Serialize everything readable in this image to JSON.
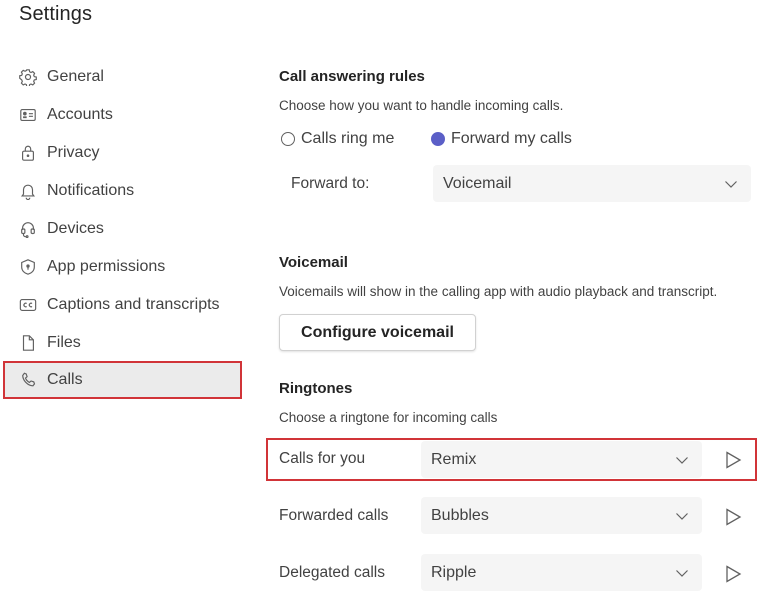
{
  "page": {
    "title": "Settings"
  },
  "sidebar": {
    "items": [
      {
        "label": "General",
        "icon": "gear-icon"
      },
      {
        "label": "Accounts",
        "icon": "id-card-icon"
      },
      {
        "label": "Privacy",
        "icon": "lock-icon"
      },
      {
        "label": "Notifications",
        "icon": "bell-icon"
      },
      {
        "label": "Devices",
        "icon": "headset-icon"
      },
      {
        "label": "App permissions",
        "icon": "shield-icon"
      },
      {
        "label": "Captions and transcripts",
        "icon": "closed-captions-icon"
      },
      {
        "label": "Files",
        "icon": "file-icon"
      },
      {
        "label": "Calls",
        "icon": "phone-icon",
        "active": true
      }
    ]
  },
  "call_answering": {
    "title": "Call answering rules",
    "description": "Choose how you want to handle incoming calls.",
    "options": [
      {
        "label": "Calls ring me",
        "checked": false
      },
      {
        "label": "Forward my calls",
        "checked": true
      }
    ],
    "forward_to": {
      "label": "Forward to:",
      "value": "Voicemail"
    }
  },
  "voicemail": {
    "title": "Voicemail",
    "description": "Voicemails will show in the calling app with audio playback and transcript.",
    "configure_button": "Configure voicemail"
  },
  "ringtones": {
    "title": "Ringtones",
    "description": "Choose a ringtone for incoming calls",
    "rows": [
      {
        "label": "Calls for you",
        "value": "Remix",
        "highlighted": true
      },
      {
        "label": "Forwarded calls",
        "value": "Bubbles"
      },
      {
        "label": "Delegated calls",
        "value": "Ripple"
      }
    ]
  },
  "colors": {
    "accent": "#5b5fc7",
    "highlight_border": "#d13438",
    "active_nav_bg": "#ebebeb",
    "select_bg": "#f5f5f5"
  }
}
